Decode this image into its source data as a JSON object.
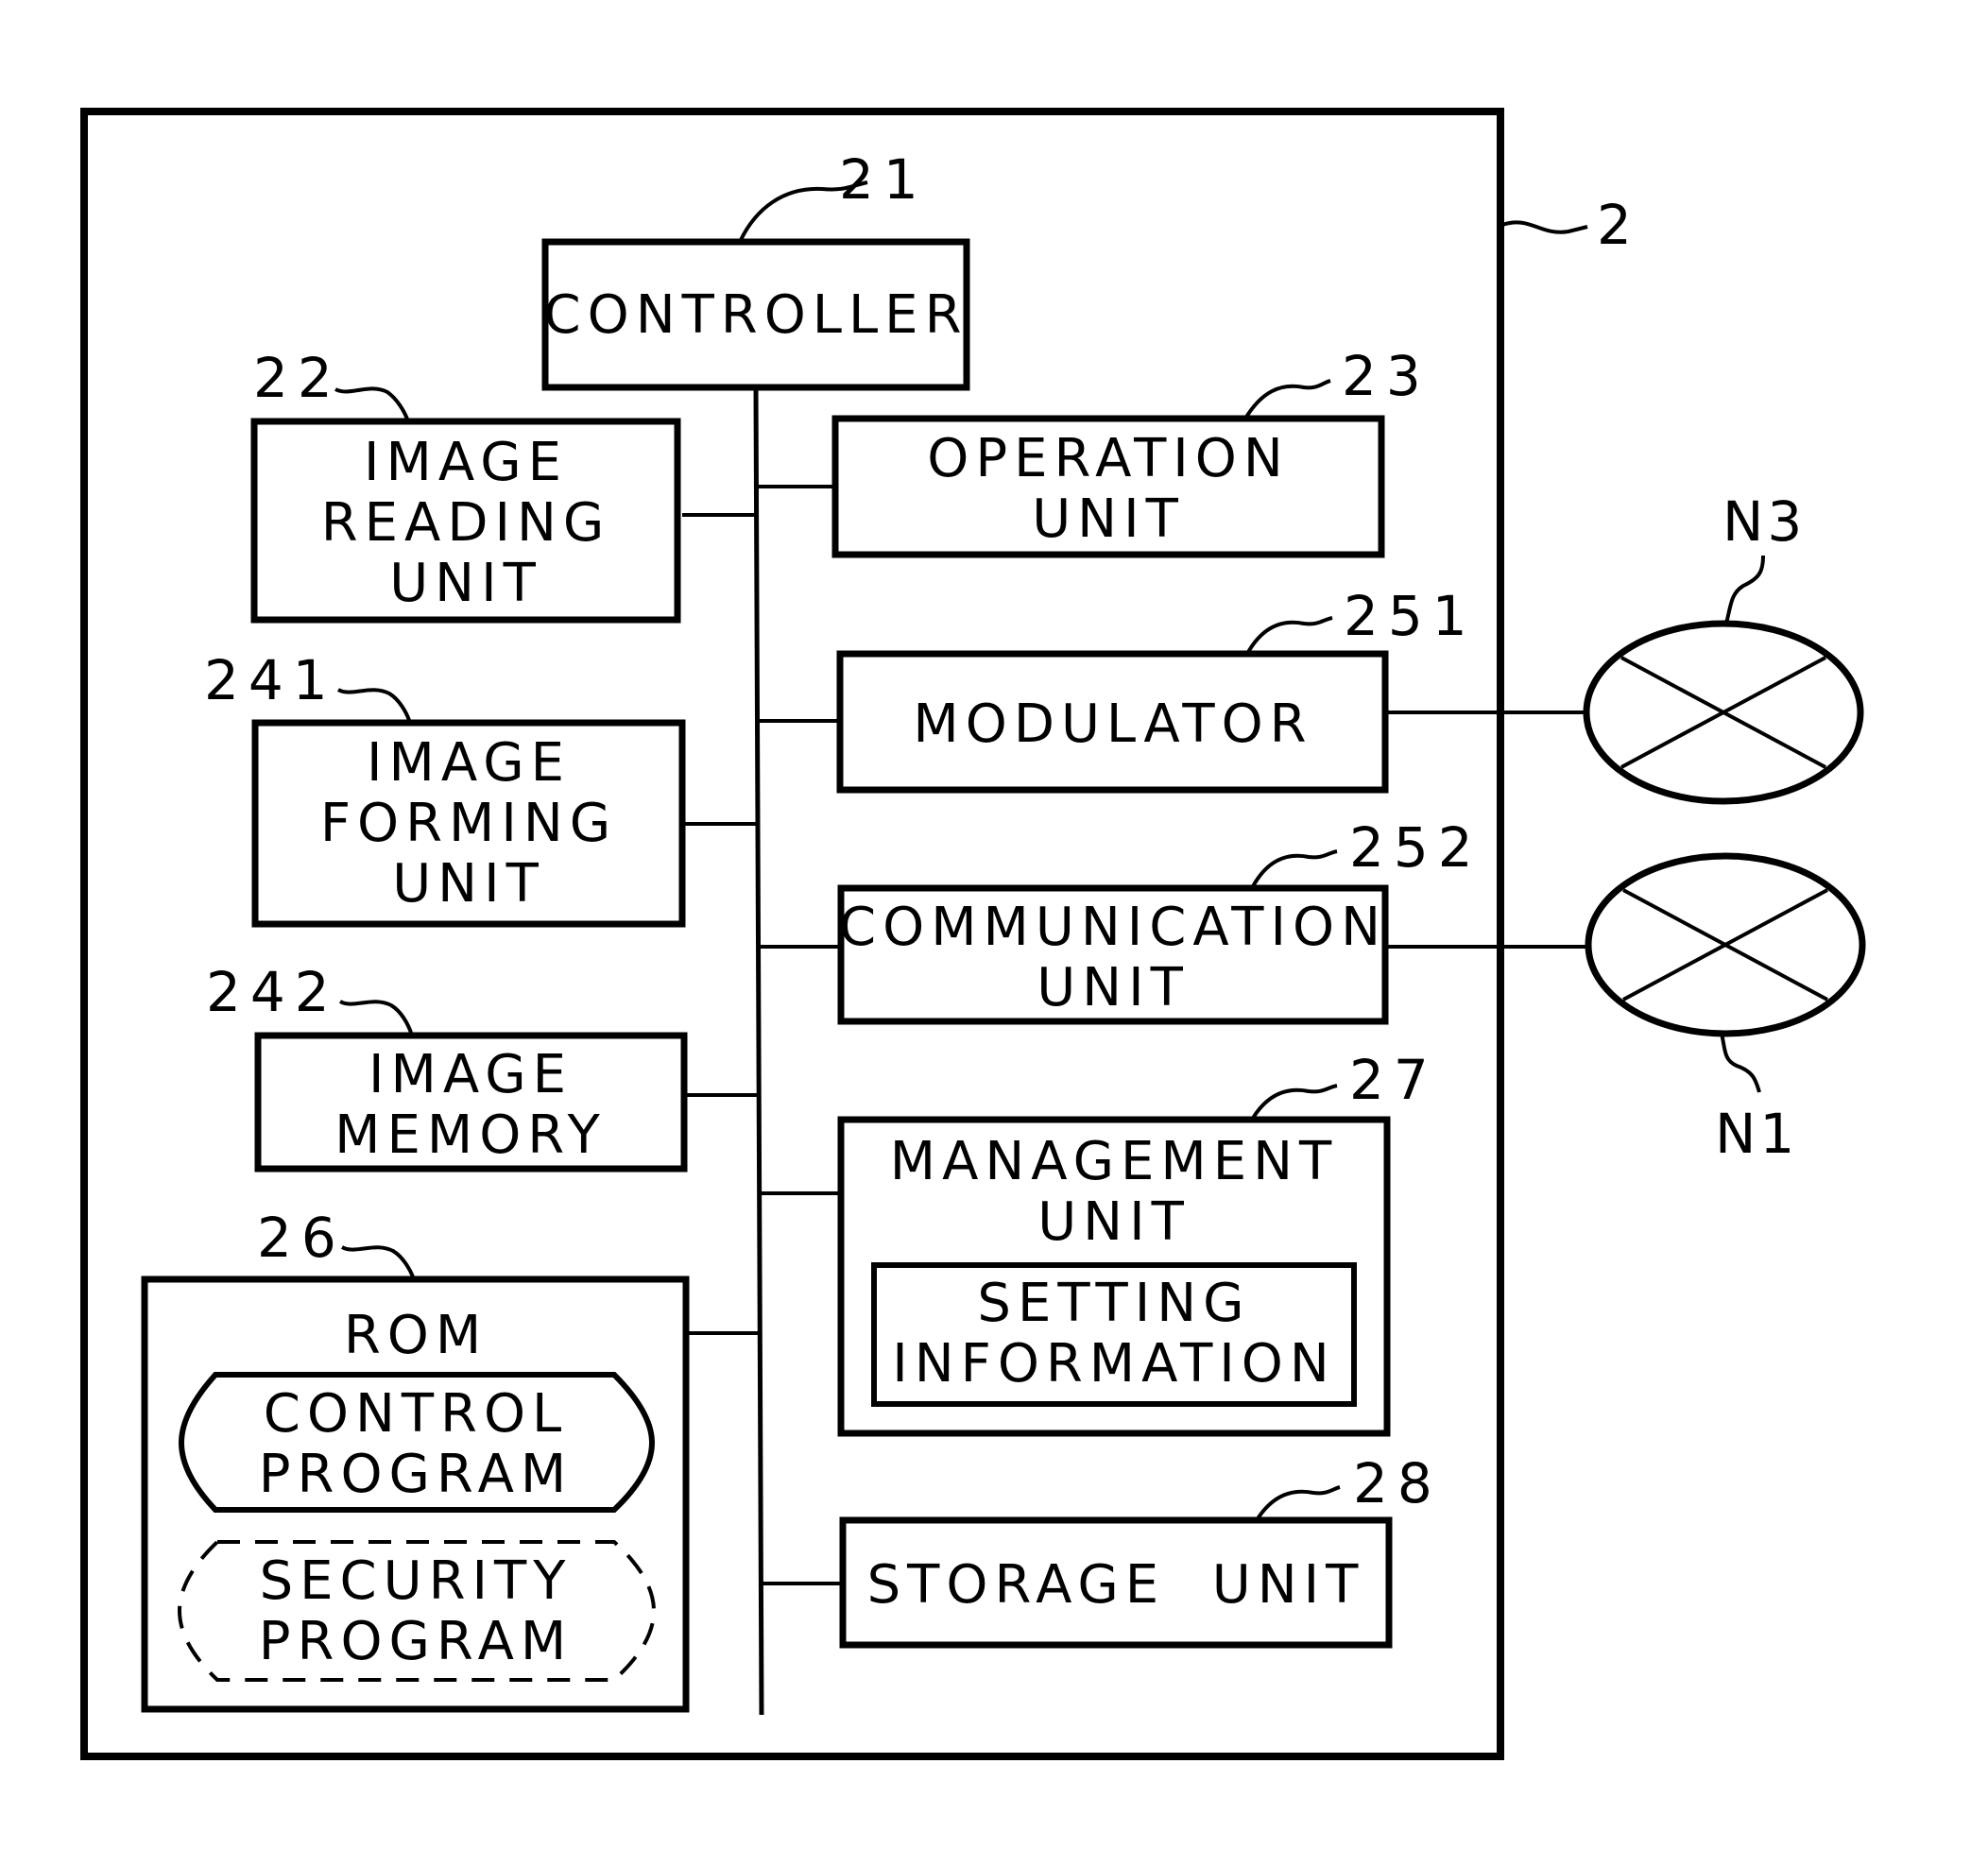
{
  "figure": {
    "device_ref": "2",
    "controller": {
      "ref": "21",
      "label": "CONTROLLER"
    },
    "left_units": [
      {
        "ref": "22",
        "lines": [
          "IMAGE",
          "READING",
          "UNIT"
        ]
      },
      {
        "ref": "241",
        "lines": [
          "IMAGE",
          "FORMING",
          "UNIT"
        ]
      },
      {
        "ref": "242",
        "lines": [
          "IMAGE",
          "MEMORY"
        ]
      }
    ],
    "rom": {
      "ref": "26",
      "label": "ROM",
      "control_program": [
        "CONTROL",
        "PROGRAM"
      ],
      "security_program": [
        "SECURITY",
        "PROGRAM"
      ]
    },
    "right_units": [
      {
        "ref": "23",
        "lines": [
          "OPERATION",
          "UNIT"
        ]
      },
      {
        "ref": "251",
        "lines": [
          "MODULATOR"
        ]
      },
      {
        "ref": "252",
        "lines": [
          "COMMUNICATION",
          "UNIT"
        ]
      }
    ],
    "management": {
      "ref": "27",
      "lines": [
        "MANAGEMENT",
        "UNIT"
      ],
      "setting_info": [
        "SETTING",
        "INFORMATION"
      ]
    },
    "storage": {
      "ref": "28",
      "label": "STORAGE  UNIT"
    },
    "networks": [
      {
        "label": "N3",
        "connected_to": "251"
      },
      {
        "label": "N1",
        "connected_to": "252"
      }
    ]
  }
}
